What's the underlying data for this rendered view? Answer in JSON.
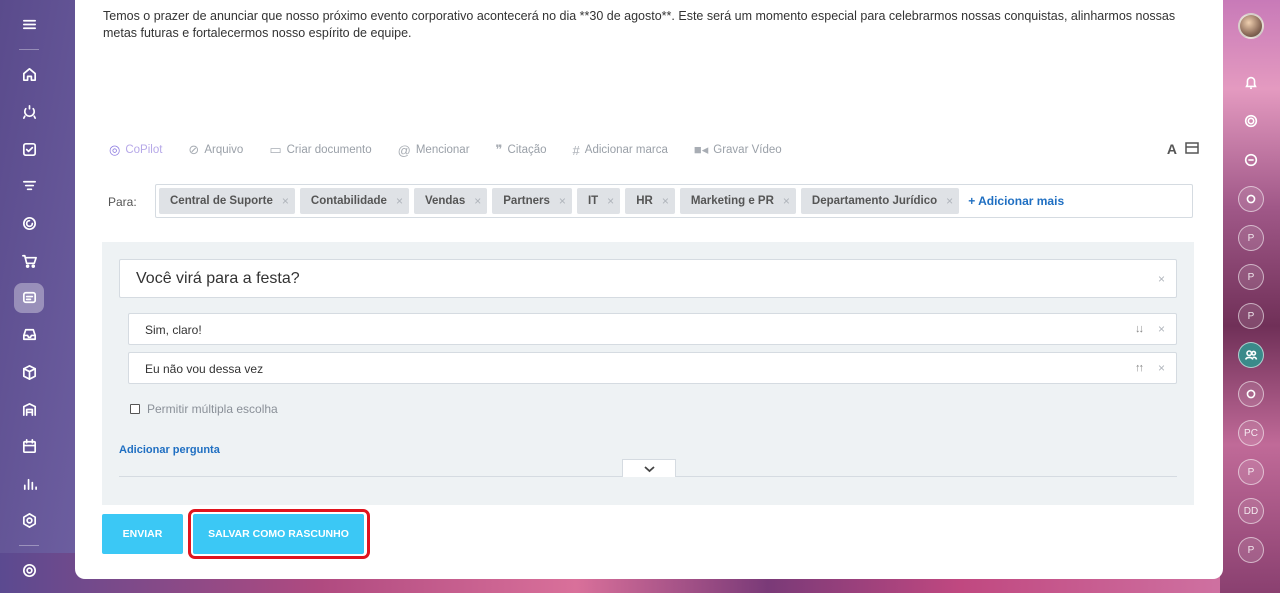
{
  "message": {
    "text": "Temos o prazer de anunciar que nosso próximo evento corporativo acontecerá no dia **30 de agosto**. Este será um momento especial para celebrarmos nossas conquistas, alinharmos nossas metas futuras e fortalecermos nosso espírito de equipe."
  },
  "toolbar": {
    "copilot": "CoPilot",
    "file": "Arquivo",
    "create_doc": "Criar documento",
    "mention": "Mencionar",
    "quote": "Citação",
    "tag": "Adicionar marca",
    "record_video": "Gravar Vídeo",
    "font_label": "A"
  },
  "recipients": {
    "label": "Para:",
    "tags": [
      "Central de Suporte",
      "Contabilidade",
      "Vendas",
      "Partners",
      "IT",
      "HR",
      "Marketing e PR",
      "Departamento Jurídico"
    ],
    "add_more": "+ Adicionar mais"
  },
  "poll": {
    "question": "Você virá para a festa?",
    "answers": [
      "Sim, claro!",
      "Eu não vou dessa vez"
    ],
    "multiple_choice_label": "Permitir múltipla escolha",
    "add_question": "Adicionar pergunta"
  },
  "actions": {
    "send": "ENVIAR",
    "save_draft": "SALVAR COMO RASCUNHO"
  },
  "colors": {
    "button": "#3bc8f5",
    "link": "#1f6fc2",
    "highlight": "#e0141e"
  }
}
